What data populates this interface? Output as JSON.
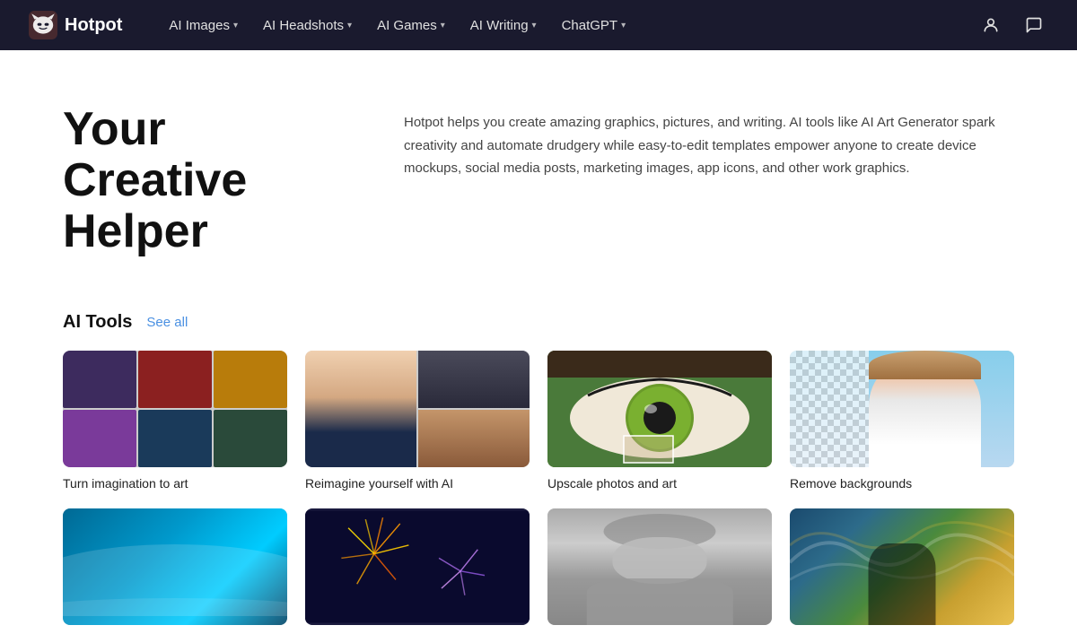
{
  "nav": {
    "logo_text": "Hotpot",
    "links": [
      {
        "label": "AI Images",
        "has_dropdown": true
      },
      {
        "label": "AI Headshots",
        "has_dropdown": true
      },
      {
        "label": "AI Games",
        "has_dropdown": true
      },
      {
        "label": "AI Writing",
        "has_dropdown": true
      },
      {
        "label": "ChatGPT",
        "has_dropdown": true
      }
    ]
  },
  "hero": {
    "title_line1": "Your Creative",
    "title_line2": "Helper",
    "description": "Hotpot helps you create amazing graphics, pictures, and writing. AI tools like AI Art Generator spark creativity and automate drudgery while easy-to-edit templates empower anyone to create device mockups, social media posts, marketing images, app icons, and other work graphics."
  },
  "tools_section": {
    "title": "AI Tools",
    "see_all": "See all",
    "tools": [
      {
        "label": "Turn imagination to art",
        "type": "art"
      },
      {
        "label": "Reimagine yourself with AI",
        "type": "headshots"
      },
      {
        "label": "Upscale photos and art",
        "type": "upscale"
      },
      {
        "label": "Remove backgrounds",
        "type": "bg-remove"
      },
      {
        "label": "",
        "type": "wave"
      },
      {
        "label": "",
        "type": "fireworks"
      },
      {
        "label": "",
        "type": "portrait-bw"
      },
      {
        "label": "",
        "type": "painting"
      }
    ]
  }
}
